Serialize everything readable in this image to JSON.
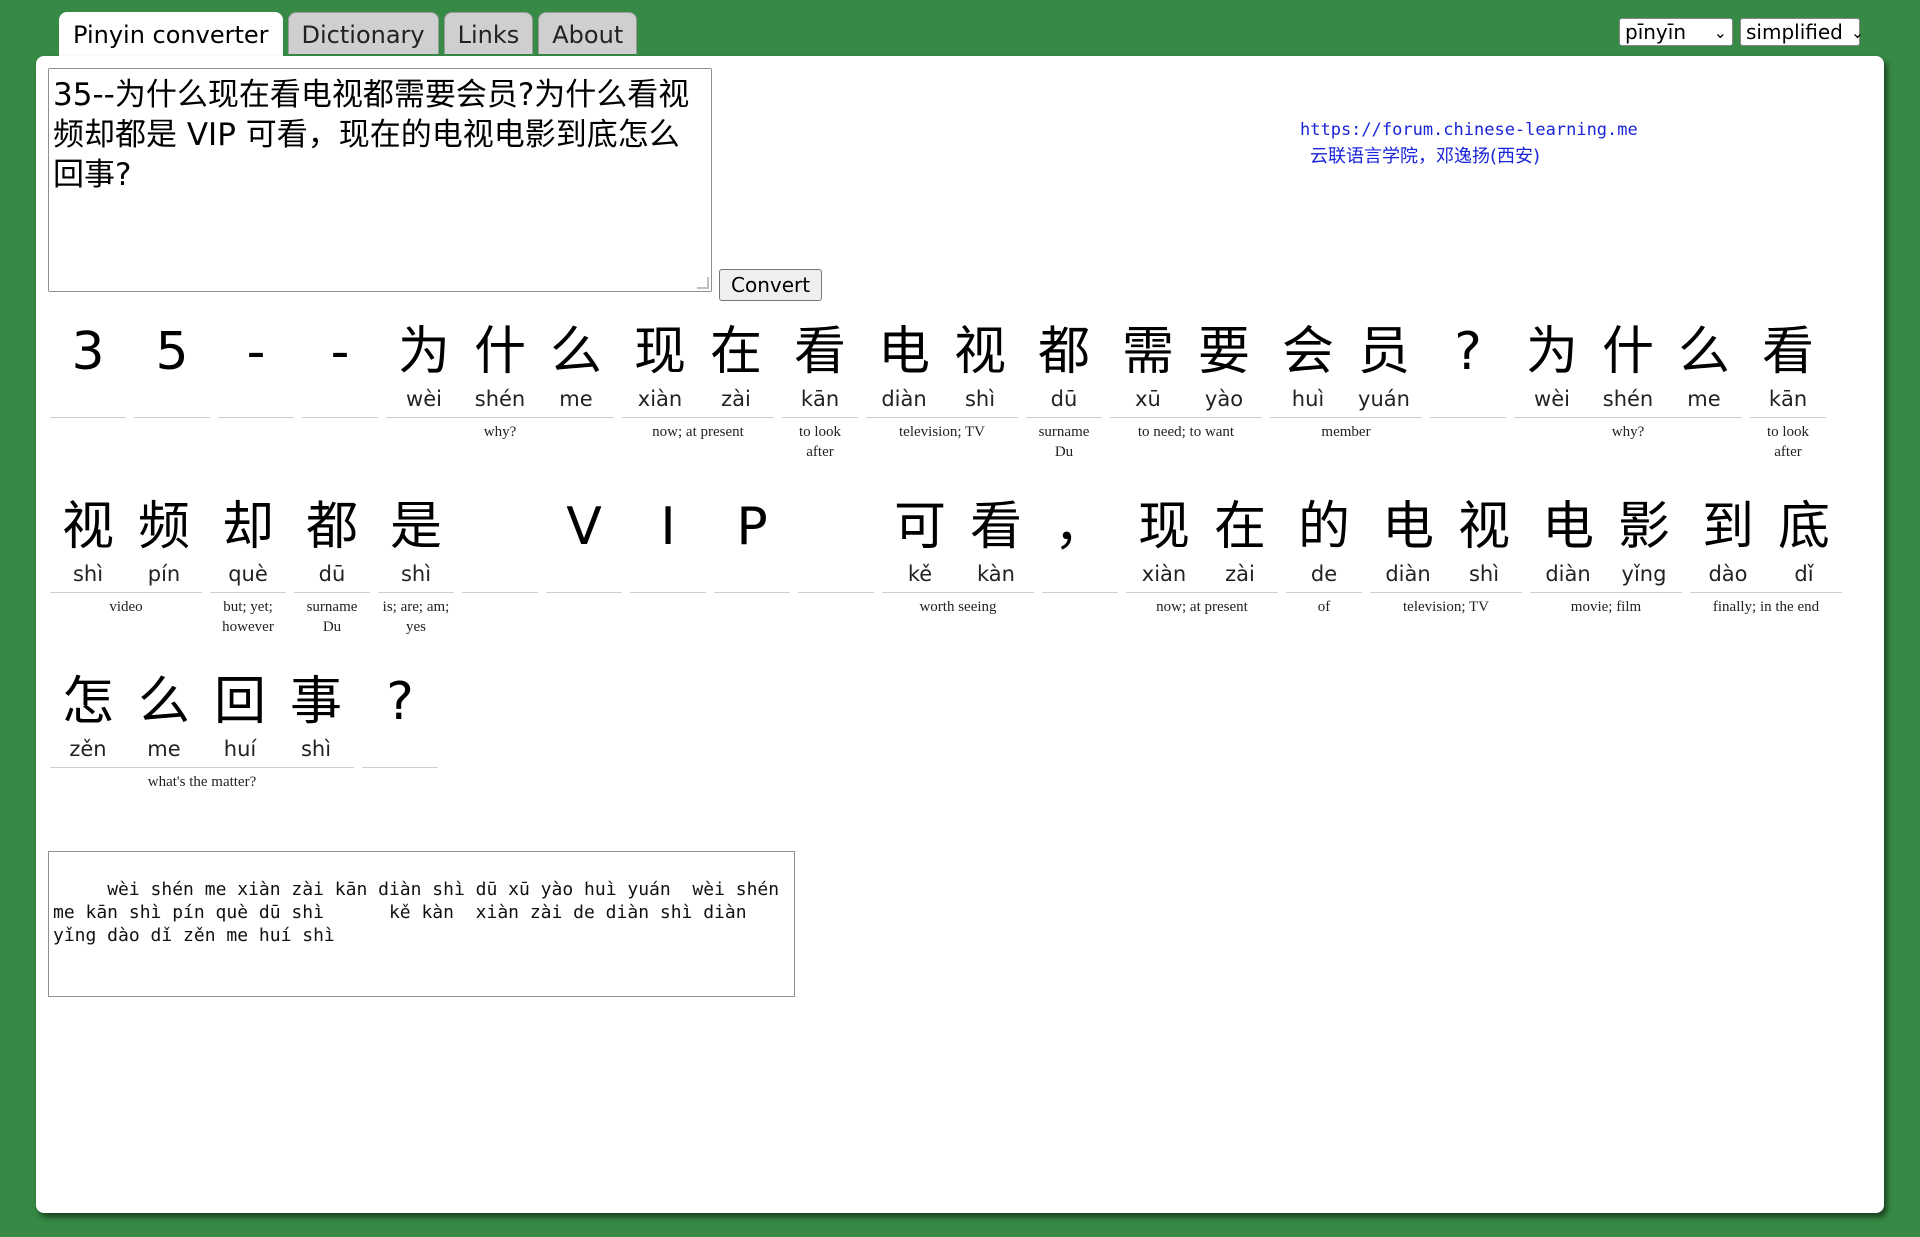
{
  "tabs": [
    {
      "label": "Pinyin converter",
      "active": true
    },
    {
      "label": "Dictionary"
    },
    {
      "label": "Links"
    },
    {
      "label": "About"
    }
  ],
  "selects": {
    "mode": "pīnyīn",
    "script": "simplified"
  },
  "input_text": "35--为什么现在看电视都需要会员?为什么看视频却都是 VIP 可看，现在的电视电影到底怎么回事?",
  "convert_label": "Convert",
  "forum": {
    "url": "https://forum.chinese-learning.me",
    "school": "云联语言学院，邓逸扬(西安)"
  },
  "rows": [
    [
      {
        "chars": [
          {
            "h": "3",
            "p": ""
          }
        ],
        "def": ""
      },
      {
        "chars": [
          {
            "h": "5",
            "p": ""
          }
        ],
        "def": ""
      },
      {
        "chars": [
          {
            "h": "-",
            "p": ""
          }
        ],
        "def": ""
      },
      {
        "chars": [
          {
            "h": "-",
            "p": ""
          }
        ],
        "def": ""
      },
      {
        "chars": [
          {
            "h": "为",
            "p": "wèi"
          },
          {
            "h": "什",
            "p": "shén"
          },
          {
            "h": "么",
            "p": "me"
          }
        ],
        "def": "why?"
      },
      {
        "chars": [
          {
            "h": "现",
            "p": "xiàn"
          },
          {
            "h": "在",
            "p": "zài"
          }
        ],
        "def": "now; at present"
      },
      {
        "chars": [
          {
            "h": "看",
            "p": "kān"
          }
        ],
        "def": "to look after"
      },
      {
        "chars": [
          {
            "h": "电",
            "p": "diàn"
          },
          {
            "h": "视",
            "p": "shì"
          }
        ],
        "def": "television; TV"
      },
      {
        "chars": [
          {
            "h": "都",
            "p": "dū"
          }
        ],
        "def": "surname Du"
      },
      {
        "chars": [
          {
            "h": "需",
            "p": "xū"
          },
          {
            "h": "要",
            "p": "yào"
          }
        ],
        "def": "to need; to want"
      },
      {
        "chars": [
          {
            "h": "会",
            "p": "huì"
          },
          {
            "h": "员",
            "p": "yuán"
          }
        ],
        "def": "member"
      },
      {
        "chars": [
          {
            "h": "?",
            "p": ""
          }
        ],
        "def": ""
      },
      {
        "chars": [
          {
            "h": "为",
            "p": "wèi"
          },
          {
            "h": "什",
            "p": "shén"
          },
          {
            "h": "么",
            "p": "me"
          }
        ],
        "def": "why?"
      },
      {
        "chars": [
          {
            "h": "看",
            "p": "kān"
          }
        ],
        "def": "to look after"
      }
    ],
    [
      {
        "chars": [
          {
            "h": "视",
            "p": "shì"
          },
          {
            "h": "频",
            "p": "pín"
          }
        ],
        "def": "video"
      },
      {
        "chars": [
          {
            "h": "却",
            "p": "què"
          }
        ],
        "def": "but; yet; however"
      },
      {
        "chars": [
          {
            "h": "都",
            "p": "dū"
          }
        ],
        "def": "surname Du"
      },
      {
        "chars": [
          {
            "h": "是",
            "p": "shì"
          }
        ],
        "def": "is; are; am; yes"
      },
      {
        "chars": [
          {
            "h": "",
            "p": ""
          }
        ],
        "def": ""
      },
      {
        "chars": [
          {
            "h": "V",
            "p": ""
          }
        ],
        "def": ""
      },
      {
        "chars": [
          {
            "h": "I",
            "p": ""
          }
        ],
        "def": ""
      },
      {
        "chars": [
          {
            "h": "P",
            "p": ""
          }
        ],
        "def": ""
      },
      {
        "chars": [
          {
            "h": "",
            "p": ""
          }
        ],
        "def": ""
      },
      {
        "chars": [
          {
            "h": "可",
            "p": "kě"
          },
          {
            "h": "看",
            "p": "kàn"
          }
        ],
        "def": "worth seeing"
      },
      {
        "chars": [
          {
            "h": "，",
            "p": ""
          }
        ],
        "def": ""
      },
      {
        "chars": [
          {
            "h": "现",
            "p": "xiàn"
          },
          {
            "h": "在",
            "p": "zài"
          }
        ],
        "def": "now; at present"
      },
      {
        "chars": [
          {
            "h": "的",
            "p": "de"
          }
        ],
        "def": "of"
      },
      {
        "chars": [
          {
            "h": "电",
            "p": "diàn"
          },
          {
            "h": "视",
            "p": "shì"
          }
        ],
        "def": "television; TV"
      },
      {
        "chars": [
          {
            "h": "电",
            "p": "diàn"
          },
          {
            "h": "影",
            "p": "yǐng"
          }
        ],
        "def": "movie; film"
      },
      {
        "chars": [
          {
            "h": "到",
            "p": "dào"
          },
          {
            "h": "底",
            "p": "dǐ"
          }
        ],
        "def": "finally; in the end"
      }
    ],
    [
      {
        "chars": [
          {
            "h": "怎",
            "p": "zěn"
          },
          {
            "h": "么",
            "p": "me"
          },
          {
            "h": "回",
            "p": "huí"
          },
          {
            "h": "事",
            "p": "shì"
          }
        ],
        "def": "what's the matter?"
      },
      {
        "chars": [
          {
            "h": "?",
            "p": ""
          }
        ],
        "def": ""
      }
    ]
  ],
  "output_text": "   wèi shén me xiàn zài kān diàn shì dū xū yào huì yuán  wèi shén me kān shì pín què dū shì      kě kàn  xiàn zài de diàn shì diàn yǐng dào dǐ zěn me huí shì"
}
